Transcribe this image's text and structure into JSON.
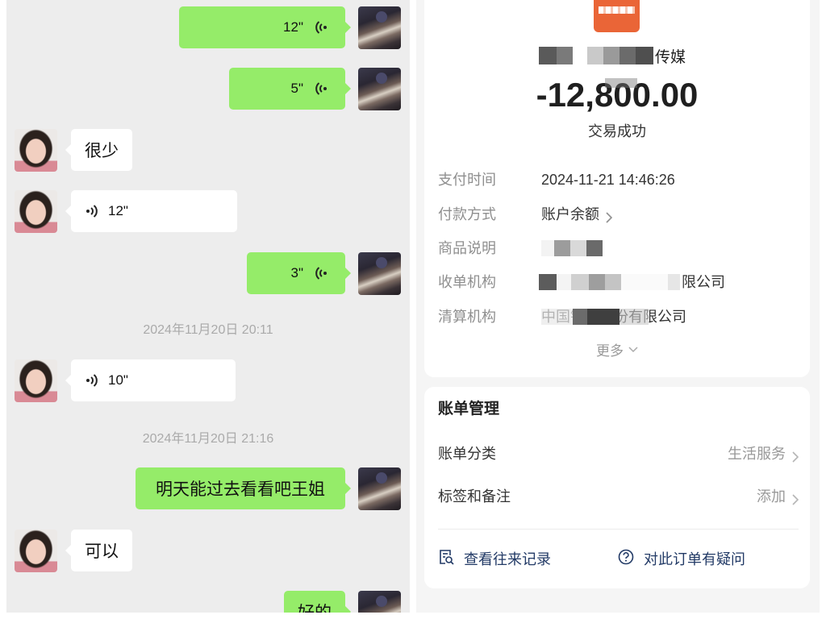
{
  "chat": {
    "messages": [
      {
        "text": "12\"",
        "icon": "voice-icon"
      },
      {
        "text": "5\"",
        "icon": "voice-icon"
      },
      {
        "text": "很少"
      },
      {
        "text": "12\"",
        "icon": "voice-icon"
      },
      {
        "text": "3\"",
        "icon": "voice-icon"
      },
      {
        "text": "10\"",
        "icon": "voice-icon"
      },
      {
        "text": "明天能过去看看吧王姐"
      },
      {
        "text": "可以"
      },
      {
        "text": "好的"
      }
    ],
    "timestamps": [
      "2024年11月20日 20:11",
      "2024年11月20日 21:16"
    ]
  },
  "bill_detail": {
    "merchant_visible": "传媒",
    "amount": "-12,800.00",
    "status": "交易成功",
    "rows": [
      {
        "label": "支付时间",
        "value": "2024-11-21 14:46:26"
      },
      {
        "label": "付款方式",
        "value": "账户余额"
      },
      {
        "label": "商品说明"
      },
      {
        "label": "收单机构",
        "value": "限公司"
      },
      {
        "label": "清算机构",
        "value": "中国银联股份有限公司"
      }
    ],
    "more_label": "更多"
  },
  "bill_management": {
    "title": "账单管理",
    "category": {
      "label": "账单分类",
      "value": "生活服务"
    },
    "tags": {
      "label": "标签和备注",
      "value": "添加"
    },
    "history_link": "查看往来记录",
    "question_link": "对此订单有疑问"
  },
  "theme": {
    "bubble_green": "#95ec69",
    "chat_background": "#ededed",
    "link_navy": "#223a66",
    "logo_orange": "#ea6537"
  }
}
